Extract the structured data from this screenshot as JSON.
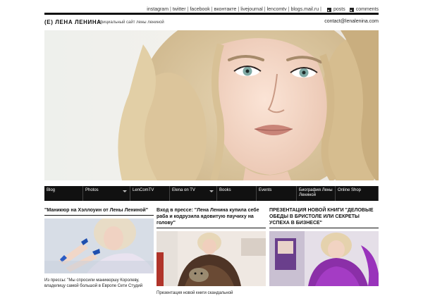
{
  "topbar": {
    "links": [
      "instagram",
      "twitter",
      "facebook",
      "вконтакте",
      "livejournal",
      "lencomtv",
      "blogs.mail.ru"
    ],
    "posts": "posts",
    "comments": "comments",
    "rss_icon": "rss-icon"
  },
  "header": {
    "brand": "(E) ЛЕНА ЛЕНИНА",
    "tagline": "официальный сайт лены лениной",
    "contact": "contact@lenalenina.com"
  },
  "nav": {
    "items": [
      {
        "label": "Blog"
      },
      {
        "label": "Photos"
      },
      {
        "label": "LenComTV"
      },
      {
        "label": "Elena on TV"
      },
      {
        "label": "Books"
      },
      {
        "label": "Events"
      },
      {
        "label": "Биография Лены Лениной"
      },
      {
        "label": "Online Shop"
      }
    ]
  },
  "posts": [
    {
      "title": "\"Маникюр на Хэллоуин от Лены Лениной\"",
      "excerpt": "Из прессы: \"Мы спросили маникюршу Королеву, владелицу самой большой в Европе Сети Студий"
    },
    {
      "title": "Вход в прессе: \"Лена Ленина купила себе раба и кодрузила ядовитую паучиху на голову\"",
      "excerpt": "Презентация новой книги скандальной"
    },
    {
      "title": "ПРЕЗЕНТАЦИЯ НОВОЙ КНИГИ \"ДЕЛОВЫЕ ОБЕДЫ В БРИСТОЛЕ ИЛИ СЕКРЕТЫ УСПЕХА В БИЗНЕСЕ\"",
      "excerpt": ""
    }
  ]
}
